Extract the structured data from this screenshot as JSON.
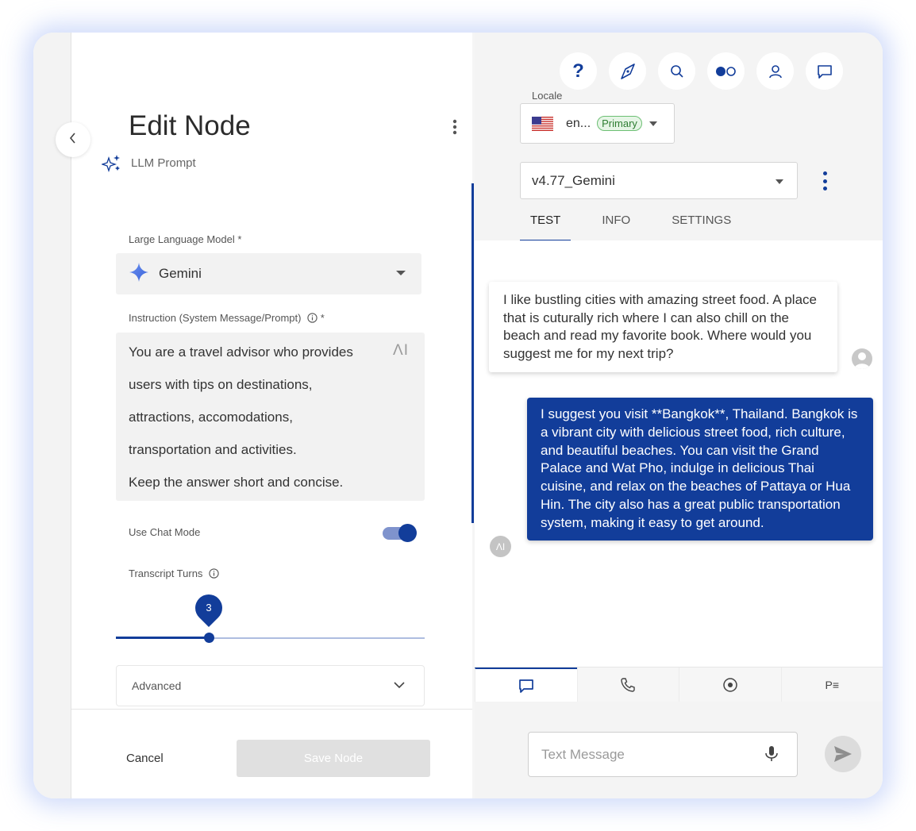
{
  "colors": {
    "primary": "#123d9a",
    "badge_green": "#2e7d32"
  },
  "editor": {
    "title": "Edit Node",
    "subtitle": "LLM Prompt",
    "llm_label": "Large Language Model *",
    "llm_value": "Gemini",
    "instruction_label": "Instruction (System Message/Prompt)",
    "instruction_required": "*",
    "instruction_lines": [
      "You are a travel advisor who provides",
      "users with tips on destinations,",
      "attractions, accomodations,",
      "transportation and activities.",
      "Keep the answer short and concise."
    ],
    "ai_mark": "ΛI",
    "chat_mode_label": "Use Chat Mode",
    "chat_mode_on": true,
    "transcript_label": "Transcript Turns",
    "transcript_value": "3",
    "transcript_fraction": 0.3,
    "advanced_label": "Advanced",
    "cancel_label": "Cancel",
    "save_label": "Save Node"
  },
  "tester": {
    "top_icons": [
      "help-icon",
      "compass-icon",
      "search-icon",
      "toggle-view-icon",
      "user-icon",
      "chat-icon"
    ],
    "help_glyph": "?",
    "locale_label": "Locale",
    "locale_value": "en...",
    "locale_badge": "Primary",
    "version_value": "v4.77_Gemini",
    "tabs": [
      "TEST",
      "INFO",
      "SETTINGS"
    ],
    "active_tab": "TEST",
    "user_message": "I like bustling cities with amazing street food. A place that is cuturally rich where I can also chill on the beach and read my favorite book. Where would you suggest me for my next trip?",
    "bot_message": "I suggest you visit **Bangkok**, Thailand. Bangkok is a vibrant city with delicious street food, rich culture, and beautiful beaches. You can visit the Grand Palace and Wat Pho, indulge in delicious Thai cuisine, and relax on the beaches of Pattaya or Hua Hin. The city also has a great public transportation system, making it easy to get around.",
    "bot_avatar_label": "ΛI",
    "bottom_tabs": {
      "chat": "chat-icon",
      "phone": "phone-icon",
      "record": "record-icon",
      "pm_label": "P≡"
    },
    "message_placeholder": "Text Message"
  }
}
